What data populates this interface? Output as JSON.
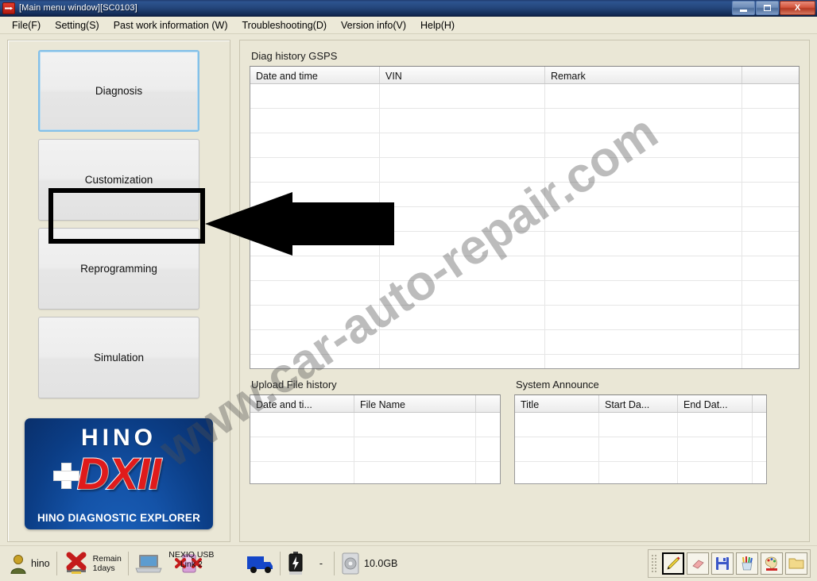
{
  "window": {
    "title": "[Main menu window][SC0103]",
    "app_icon": "hino-arrow-icon",
    "minimize_label": "Minimize",
    "maximize_label": "Restore",
    "close_label": "X"
  },
  "menubar": {
    "items": [
      {
        "label": "File(F)"
      },
      {
        "label": "Setting(S)"
      },
      {
        "label": "Past work information (W)"
      },
      {
        "label": "Troubleshooting(D)"
      },
      {
        "label": "Version info(V)"
      },
      {
        "label": "Help(H)"
      }
    ]
  },
  "sidebar": {
    "buttons": [
      {
        "label": "Diagnosis",
        "state": "focused"
      },
      {
        "label": "Customization",
        "state": "highlighted"
      },
      {
        "label": "Reprogramming",
        "state": "normal"
      },
      {
        "label": "Simulation",
        "state": "normal"
      }
    ],
    "logo": {
      "brand": "HINO",
      "product": "DXII",
      "tagline": "HINO DIAGNOSTIC EXPLORER"
    }
  },
  "main": {
    "diag_history": {
      "label": "Diag history GSPS",
      "columns": [
        "Date and time",
        "VIN",
        "Remark"
      ],
      "rows": []
    },
    "upload_history": {
      "label": "Upload File history",
      "columns": [
        "Date and ti...",
        "File Name"
      ],
      "rows": []
    },
    "system_announce": {
      "label": "System Announce",
      "columns": [
        "Title",
        "Start Da...",
        "End Dat..."
      ],
      "rows": []
    }
  },
  "statusbar": {
    "user": {
      "icon": "user-icon",
      "label": "hino"
    },
    "license": {
      "icon": "red-x-icon",
      "line1": "Remain",
      "line2": "1days"
    },
    "pc": {
      "icon": "laptop-icon"
    },
    "interface": {
      "icon": "usb-device-icon",
      "line1": "NEXIQ USB",
      "line2": "Link 2"
    },
    "vehicle": {
      "icon": "truck-icon"
    },
    "battery": {
      "icon": "battery-icon",
      "value": "-"
    },
    "disk": {
      "icon": "hard-disk-icon",
      "value": "10.0GB"
    },
    "toolbar": [
      {
        "icon": "pencil-icon",
        "label": "Pen",
        "active": true
      },
      {
        "icon": "eraser-icon",
        "label": "Eraser",
        "active": false
      },
      {
        "icon": "save-icon",
        "label": "Save",
        "active": false
      },
      {
        "icon": "pen-cup-icon",
        "label": "Pens",
        "active": false
      },
      {
        "icon": "palette-icon",
        "label": "Colors",
        "active": false
      },
      {
        "icon": "folder-icon",
        "label": "Open",
        "active": false
      }
    ]
  },
  "annotation": {
    "arrow_target": "Customization",
    "arrow_color": "#000000"
  },
  "watermark": {
    "text": "www.car-auto-repair.com"
  },
  "colors": {
    "window_bg": "#eae7d6",
    "title_bar": "#24457a",
    "focus_border": "#84c0e8",
    "grid_bg": "#ffffff",
    "logo_blue": "#0b3d85",
    "logo_red": "#e01b1b"
  }
}
